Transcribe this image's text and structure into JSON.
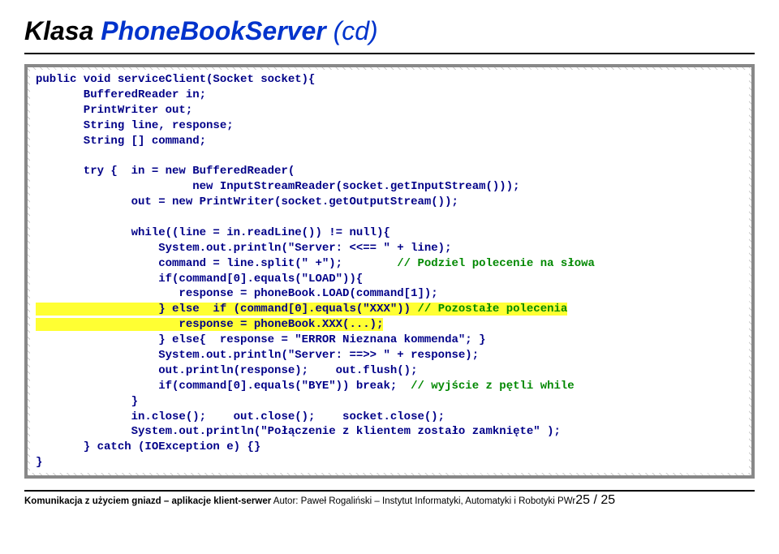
{
  "title": {
    "part1": "Klasa ",
    "part2": "PhoneBookServer ",
    "part3": "(cd)"
  },
  "code": {
    "l01": "public void serviceClient(Socket socket){",
    "l02": "       BufferedReader in;",
    "l03": "       PrintWriter out;",
    "l04": "       String line, response;",
    "l05": "       String [] command;",
    "l06": "",
    "l07": "       try {  in = new BufferedReader(",
    "l08": "                       new InputStreamReader(socket.getInputStream()));",
    "l09": "              out = new PrintWriter(socket.getOutputStream());",
    "l10": "",
    "l11": "              while((line = in.readLine()) != null){",
    "l12": "                  System.out.println(\"Server: <<== \" + line);",
    "l13a": "                  command = line.split(\" +\");        ",
    "l13b": "// Podziel polecenie na słowa",
    "l14": "                  if(command[0].equals(\"LOAD\")){",
    "l15": "                     response = phoneBook.LOAD(command[1]);",
    "l16a": "                  } else  if (command[0].equals(\"XXX\")) ",
    "l16b": "// Pozostałe polecenia",
    "l17": "                     response = phoneBook.XXX(...);",
    "l18": "                  } else{  response = \"ERROR Nieznana kommenda\"; }",
    "l19": "                  System.out.println(\"Server: ==>> \" + response);",
    "l20": "                  out.println(response);    out.flush();",
    "l21a": "                  if(command[0].equals(\"BYE\")) break;  ",
    "l21b": "// wyjście z pętli while",
    "l22": "              }",
    "l23": "              in.close();    out.close();    socket.close();",
    "l24": "              System.out.println(\"Połączenie z klientem zostało zamknięte\" );",
    "l25": "       } catch (IOException e) {}",
    "l26": "}"
  },
  "footer": {
    "left": "Komunikacja z użyciem gniazd – aplikacje klient-serwer",
    "author_label": "  Autor: Paweł Rogaliński – Instytut Informatyki, Automatyki i Robotyki PWr",
    "page": "25 / 25"
  }
}
